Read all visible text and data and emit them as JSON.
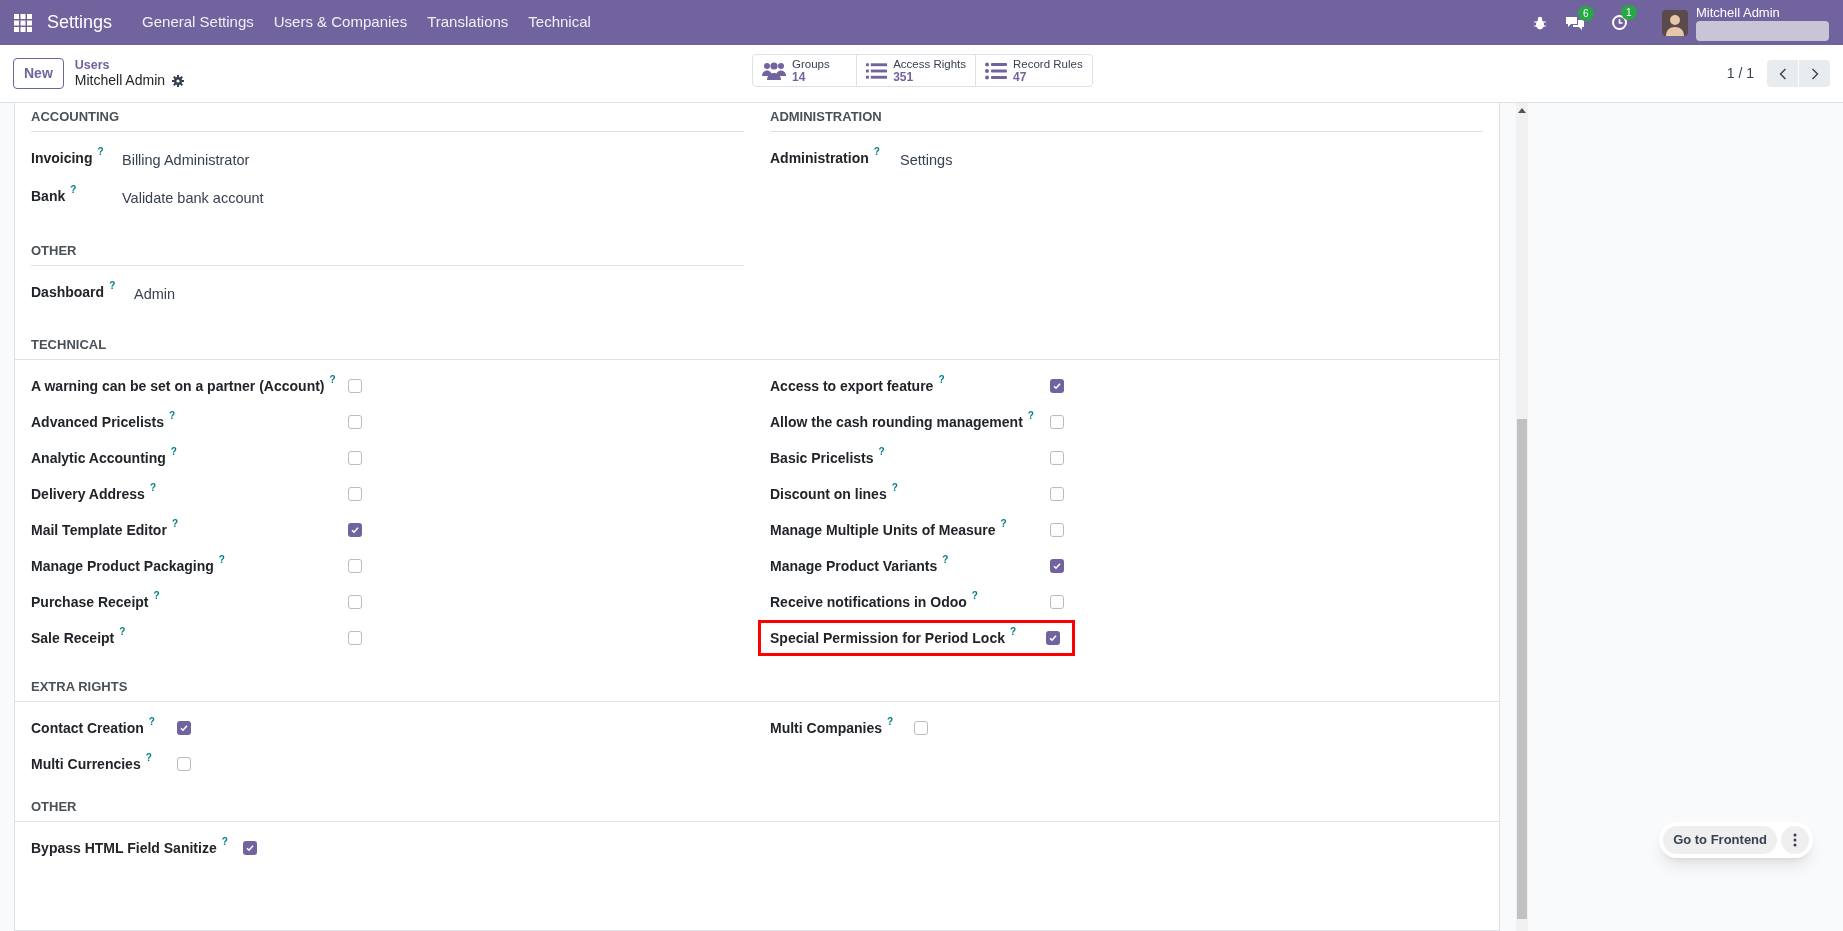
{
  "navbar": {
    "app_title": "Settings",
    "menu": [
      "General Settings",
      "Users & Companies",
      "Translations",
      "Technical"
    ],
    "chat_badge": "6",
    "activity_badge": "1",
    "user_name": "Mitchell Admin"
  },
  "control_panel": {
    "new_button": "New",
    "breadcrumb": "Users",
    "record_name": "Mitchell Admin",
    "smart_buttons": [
      {
        "kind": "groups",
        "label": "Groups",
        "count": "14"
      },
      {
        "kind": "list",
        "label": "Access Rights",
        "count": "351"
      },
      {
        "kind": "rules",
        "label": "Record Rules",
        "count": "47"
      }
    ],
    "pager": "1 / 1"
  },
  "form": {
    "accounting": {
      "title": "ACCOUNTING",
      "fields": [
        {
          "label": "Invoicing",
          "help": "?",
          "value": "Billing Administrator"
        },
        {
          "label": "Bank",
          "help": "?",
          "value": "Validate bank account"
        }
      ]
    },
    "administration": {
      "title": "ADMINISTRATION",
      "fields": [
        {
          "label": "Administration",
          "help": "?",
          "value": "Settings"
        }
      ]
    },
    "other": {
      "title": "OTHER",
      "fields": [
        {
          "label": "Dashboard",
          "help": "?",
          "value": "Admin"
        }
      ]
    },
    "technical": {
      "title": "TECHNICAL",
      "left": [
        {
          "label": "A warning can be set on a partner (Account)",
          "help": "?",
          "checked": false,
          "highlighted": false
        },
        {
          "label": "Advanced Pricelists",
          "help": "?",
          "checked": false,
          "highlighted": false
        },
        {
          "label": "Analytic Accounting",
          "help": "?",
          "checked": false,
          "highlighted": false
        },
        {
          "label": "Delivery Address",
          "help": "?",
          "checked": false,
          "highlighted": false
        },
        {
          "label": "Mail Template Editor",
          "help": "?",
          "checked": true,
          "highlighted": false
        },
        {
          "label": "Manage Product Packaging",
          "help": "?",
          "checked": false,
          "highlighted": false
        },
        {
          "label": "Purchase Receipt",
          "help": "?",
          "checked": false,
          "highlighted": false
        },
        {
          "label": "Sale Receipt",
          "help": "?",
          "checked": false,
          "highlighted": false
        }
      ],
      "right": [
        {
          "label": "Access to export feature",
          "help": "?",
          "checked": true,
          "highlighted": false
        },
        {
          "label": "Allow the cash rounding management",
          "help": "?",
          "checked": false,
          "highlighted": false
        },
        {
          "label": "Basic Pricelists",
          "help": "?",
          "checked": false,
          "highlighted": false
        },
        {
          "label": "Discount on lines",
          "help": "?",
          "checked": false,
          "highlighted": false
        },
        {
          "label": "Manage Multiple Units of Measure",
          "help": "?",
          "checked": false,
          "highlighted": false
        },
        {
          "label": "Manage Product Variants",
          "help": "?",
          "checked": true,
          "highlighted": false
        },
        {
          "label": "Receive notifications in Odoo",
          "help": "?",
          "checked": false,
          "highlighted": false
        },
        {
          "label": "Special Permission for Period Lock",
          "help": "?",
          "checked": true,
          "highlighted": true
        }
      ]
    },
    "extra_rights": {
      "title": "EXTRA RIGHTS",
      "left": [
        {
          "label": "Contact Creation",
          "help": "?",
          "checked": true
        },
        {
          "label": "Multi Currencies",
          "help": "?",
          "checked": false
        }
      ],
      "right": [
        {
          "label": "Multi Companies",
          "help": "?",
          "checked": false
        }
      ]
    },
    "other_2": {
      "title": "OTHER",
      "left": [
        {
          "label": "Bypass HTML Field Sanitize",
          "help": "?",
          "checked": true
        }
      ]
    }
  },
  "frontend_button": "Go to Frontend"
}
